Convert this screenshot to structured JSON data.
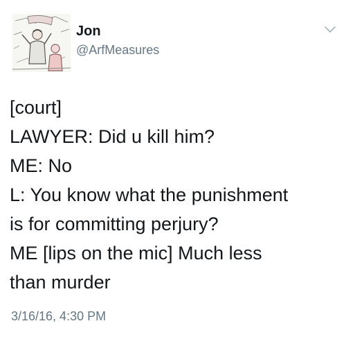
{
  "tweet": {
    "author": {
      "name": "Jon",
      "handle": "@ArfMeasures",
      "avatar_icon": "profile-photo-sketch"
    },
    "menu_icon": "chevron-down-icon",
    "lines": [
      "[court]",
      "LAWYER: Did u kill him?",
      "ME: No",
      "L: You know what the punishment",
      "is for committing perjury?",
      "ME [lips on the mic] Much less",
      "than murder"
    ],
    "timestamp": "3/16/16, 4:30 PM"
  },
  "colors": {
    "text": "#14171a",
    "secondary": "#657786",
    "chevron": "#aab8c2",
    "background": "#ffffff"
  }
}
